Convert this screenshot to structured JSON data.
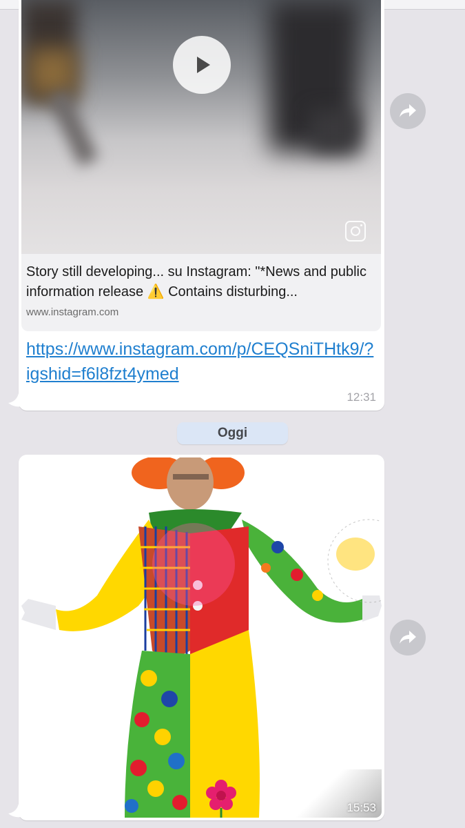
{
  "message_1": {
    "preview_title": "Story still developing... su Instagram: \"*News and public information release ⚠️ Contains disturbing...",
    "preview_domain": "www.instagram.com",
    "link": "https://www.instagram.com/p/CEQSniTHtk9/?igshid=f6l8fzt4ymed",
    "time": "12:31",
    "video_play_icon": "play-icon",
    "source_icon": "instagram-icon"
  },
  "date_separator": "Oggi",
  "message_2": {
    "time": "15:53"
  },
  "forward_icon": "forward-arrow-icon",
  "colors": {
    "background": "#e6e4e9",
    "bubble": "#ffffff",
    "link": "#1f7fcf",
    "date_pill": "#dbe6f6",
    "timestamp": "#a3a3a8"
  }
}
